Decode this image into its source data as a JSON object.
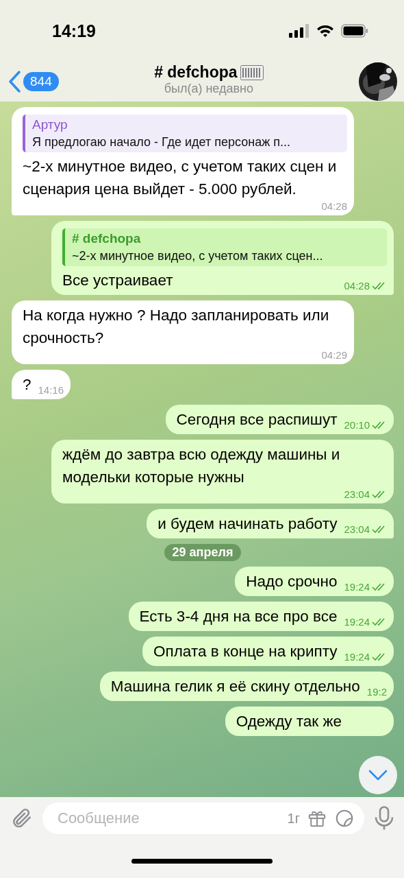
{
  "status_bar": {
    "time": "14:19"
  },
  "header": {
    "back_count": "844",
    "title": "# defchopa",
    "subtitle": "был(а) недавно"
  },
  "messages": [
    {
      "kind": "message",
      "outgoing": false,
      "tail": true,
      "reply": {
        "name": "Артур",
        "text": "Я предлогаю начало - Где идет персонаж п..."
      },
      "text": "~2-х минутное видео, с учетом таких сцен и сценария цена выйдет - 5.000 рублей.",
      "time": "04:28"
    },
    {
      "kind": "message",
      "outgoing": true,
      "tail": true,
      "read": true,
      "reply": {
        "name": "# defchopa",
        "text": "~2-х минутное видео, с учетом таких сцен..."
      },
      "text": "Все устраивает",
      "time": "04:28"
    },
    {
      "kind": "message",
      "outgoing": false,
      "tail": false,
      "text": "На когда нужно ? Надо запланировать или срочность?",
      "time": "04:29"
    },
    {
      "kind": "message",
      "outgoing": false,
      "tail": true,
      "text": "?",
      "time": "14:16"
    },
    {
      "kind": "message",
      "outgoing": true,
      "tail": false,
      "read": true,
      "text": "Сегодня все распишут",
      "time": "20:10"
    },
    {
      "kind": "message",
      "outgoing": true,
      "tail": false,
      "read": true,
      "text": "ждём до завтра всю одежду машины и модельки которые нужны",
      "time": "23:04"
    },
    {
      "kind": "message",
      "outgoing": true,
      "tail": true,
      "read": true,
      "text": "и будем начинать работу",
      "time": "23:04"
    },
    {
      "kind": "date",
      "text": "29 апреля"
    },
    {
      "kind": "message",
      "outgoing": true,
      "tail": false,
      "read": true,
      "text": "Надо срочно",
      "time": "19:24"
    },
    {
      "kind": "message",
      "outgoing": true,
      "tail": false,
      "read": true,
      "text": "Есть 3-4 дня на все про все",
      "time": "19:24"
    },
    {
      "kind": "message",
      "outgoing": true,
      "tail": false,
      "read": true,
      "text": "Оплата в конце на крипту",
      "time": "19:24"
    },
    {
      "kind": "message",
      "outgoing": true,
      "tail": false,
      "text": "Машина гелик я её скину отдельно",
      "time": "19:2"
    },
    {
      "kind": "message",
      "outgoing": true,
      "text": "Одежду так же"
    }
  ],
  "composer": {
    "placeholder": "Сообщение",
    "timer": "1г"
  }
}
